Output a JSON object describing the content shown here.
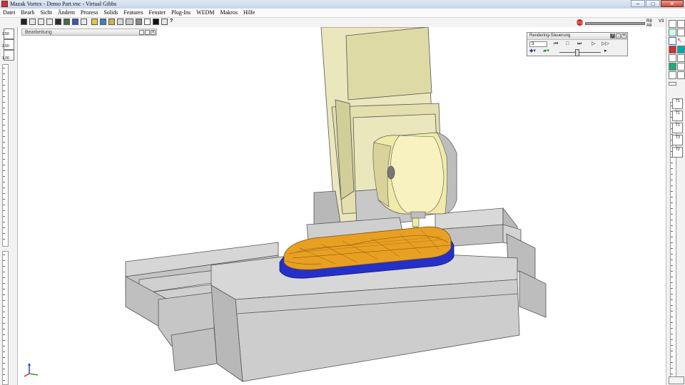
{
  "window": {
    "title": "Mazak Vortex - Demo Part.vnc - Virtual Gibbs",
    "minimize": "–",
    "maximize": "□",
    "close": "✕"
  },
  "menu": [
    "Datei",
    "Bearb",
    "Sicht",
    "Ändern",
    "Prozess",
    "Solids",
    "Features",
    "Fenster",
    "Plug-Ins",
    "WEDM",
    "Makros",
    "Hilfe"
  ],
  "toolbar": {
    "labels_right": [
      "R8",
      "A8",
      "V3"
    ]
  },
  "left_zoom": [
    "2.50",
    "2.50",
    "1.00"
  ],
  "bearbeitung": {
    "title": "Bearbeitung"
  },
  "rendering": {
    "title": "Rendering-Steuerung",
    "step_value": "3",
    "help": "?",
    "min": "_",
    "close": "x"
  },
  "tool_stations": [
    "T1",
    "T1",
    "T1",
    "T3",
    "T2"
  ],
  "colors": {
    "machine": "#c7c7c7",
    "column": "#e8e5b8",
    "part": "#e8a023",
    "fixture": "#2430c8",
    "tool": "#f0eaa8"
  }
}
